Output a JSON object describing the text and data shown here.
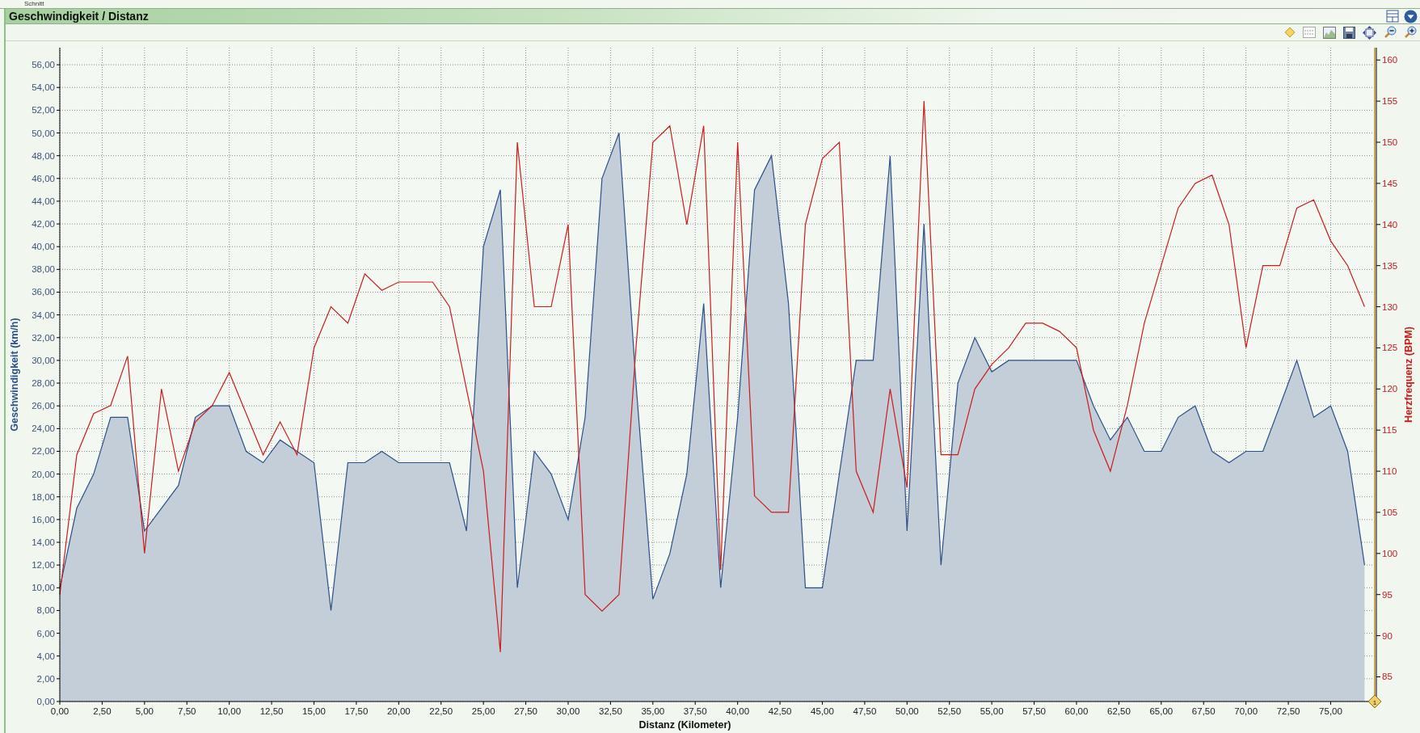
{
  "top_strip": {
    "label": "Schnitt"
  },
  "panel": {
    "title": "Geschwindigkeit / Distanz"
  },
  "chart": {
    "chart_data": {
      "type": "area",
      "xlabel": "Distanz (Kilometer)",
      "x": [
        0,
        1,
        2,
        3,
        4,
        5,
        6,
        7,
        8,
        9,
        10,
        11,
        12,
        13,
        14,
        15,
        16,
        17,
        18,
        19,
        20,
        21,
        22,
        23,
        24,
        25,
        26,
        27,
        28,
        29,
        30,
        31,
        32,
        33,
        34,
        35,
        36,
        37,
        38,
        39,
        40,
        41,
        42,
        43,
        44,
        45,
        46,
        47,
        48,
        49,
        50,
        51,
        52,
        53,
        54,
        55,
        56,
        57,
        58,
        59,
        60,
        61,
        62,
        63,
        64,
        65,
        66,
        67,
        68,
        69,
        70,
        71,
        72,
        73,
        74,
        75,
        76,
        77
      ],
      "series": [
        {
          "name": "Geschwindigkeit (km/h)",
          "color": "#2b4f8a",
          "values": [
            10,
            17,
            20,
            25,
            25,
            15,
            17,
            19,
            25,
            26,
            26,
            22,
            21,
            23,
            22,
            21,
            8,
            21,
            21,
            22,
            21,
            21,
            21,
            21,
            15,
            40,
            45,
            10,
            22,
            20,
            16,
            25,
            46,
            50,
            28,
            9,
            13,
            20,
            35,
            10,
            25,
            45,
            48,
            35,
            10,
            10,
            20,
            30,
            30,
            48,
            15,
            42,
            12,
            28,
            32,
            29,
            30,
            30,
            30,
            30,
            30,
            26,
            23,
            25,
            22,
            22,
            25,
            26,
            22,
            21,
            22,
            22,
            26,
            30,
            25,
            26,
            22,
            12
          ]
        },
        {
          "name": "Herzfrequenz (BPM)",
          "color": "#cc1b1b",
          "axis": "y2",
          "type": "line",
          "values": [
            95,
            112,
            117,
            118,
            124,
            100,
            120,
            110,
            116,
            118,
            122,
            117,
            112,
            116,
            112,
            125,
            130,
            128,
            134,
            132,
            133,
            133,
            133,
            130,
            120,
            110,
            88,
            150,
            130,
            130,
            140,
            95,
            93,
            95,
            125,
            150,
            152,
            140,
            152,
            98,
            150,
            107,
            105,
            105,
            140,
            148,
            150,
            110,
            105,
            120,
            108,
            155,
            112,
            112,
            120,
            123,
            125,
            128,
            128,
            127,
            125,
            115,
            110,
            118,
            128,
            135,
            142,
            145,
            146,
            140,
            125,
            135,
            135,
            142,
            143,
            138,
            135,
            130
          ]
        }
      ],
      "grid": true,
      "xlim": [
        0,
        77.6
      ],
      "ylim": [
        0,
        57.5
      ],
      "y2lim": [
        82,
        161.5
      ],
      "xticks": [
        {
          "value": 0,
          "label": "0,00"
        },
        {
          "value": 2.5,
          "label": "2,50"
        },
        {
          "value": 5,
          "label": "5,00"
        },
        {
          "value": 7.5,
          "label": "7,50"
        },
        {
          "value": 10,
          "label": "10,00"
        },
        {
          "value": 12.5,
          "label": "12,50"
        },
        {
          "value": 15,
          "label": "15,00"
        },
        {
          "value": 17.5,
          "label": "17,50"
        },
        {
          "value": 20,
          "label": "20,00"
        },
        {
          "value": 22.5,
          "label": "22,50"
        },
        {
          "value": 25,
          "label": "25,00"
        },
        {
          "value": 27.5,
          "label": "27,50"
        },
        {
          "value": 30,
          "label": "30,00"
        },
        {
          "value": 32.5,
          "label": "32,50"
        },
        {
          "value": 35,
          "label": "35,00"
        },
        {
          "value": 37.5,
          "label": "37,50"
        },
        {
          "value": 40,
          "label": "40,00"
        },
        {
          "value": 42.5,
          "label": "42,50"
        },
        {
          "value": 45,
          "label": "45,00"
        },
        {
          "value": 47.5,
          "label": "47,50"
        },
        {
          "value": 50,
          "label": "50,00"
        },
        {
          "value": 52.5,
          "label": "52,50"
        },
        {
          "value": 55,
          "label": "55,00"
        },
        {
          "value": 57.5,
          "label": "57,50"
        },
        {
          "value": 60,
          "label": "60,00"
        },
        {
          "value": 62.5,
          "label": "62,50"
        },
        {
          "value": 65,
          "label": "65,00"
        },
        {
          "value": 67.5,
          "label": "67,50"
        },
        {
          "value": 70,
          "label": "70,00"
        },
        {
          "value": 72.5,
          "label": "72,50"
        },
        {
          "value": 75,
          "label": "75,00"
        }
      ],
      "yticks": [
        {
          "value": 0,
          "label": "0,00"
        },
        {
          "value": 2,
          "label": "2,00"
        },
        {
          "value": 4,
          "label": "4,00"
        },
        {
          "value": 6,
          "label": "6,00"
        },
        {
          "value": 8,
          "label": "8,00"
        },
        {
          "value": 10,
          "label": "10,00"
        },
        {
          "value": 12,
          "label": "12,00"
        },
        {
          "value": 14,
          "label": "14,00"
        },
        {
          "value": 16,
          "label": "16,00"
        },
        {
          "value": 18,
          "label": "18,00"
        },
        {
          "value": 20,
          "label": "20,00"
        },
        {
          "value": 22,
          "label": "22,00"
        },
        {
          "value": 24,
          "label": "24,00"
        },
        {
          "value": 26,
          "label": "26,00"
        },
        {
          "value": 28,
          "label": "28,00"
        },
        {
          "value": 30,
          "label": "30,00"
        },
        {
          "value": 32,
          "label": "32,00"
        },
        {
          "value": 34,
          "label": "34,00"
        },
        {
          "value": 36,
          "label": "36,00"
        },
        {
          "value": 38,
          "label": "38,00"
        },
        {
          "value": 40,
          "label": "40,00"
        },
        {
          "value": 42,
          "label": "42,00"
        },
        {
          "value": 44,
          "label": "44,00"
        },
        {
          "value": 46,
          "label": "46,00"
        },
        {
          "value": 48,
          "label": "48,00"
        },
        {
          "value": 50,
          "label": "50,00"
        },
        {
          "value": 52,
          "label": "52,00"
        },
        {
          "value": 54,
          "label": "54,00"
        },
        {
          "value": 56,
          "label": "56,00"
        }
      ],
      "y2ticks": [
        85,
        90,
        95,
        100,
        105,
        110,
        115,
        120,
        125,
        130,
        135,
        140,
        145,
        150,
        155,
        160
      ],
      "annotations": [
        {
          "text": "1",
          "x": 77.6,
          "y": 0
        }
      ]
    }
  }
}
